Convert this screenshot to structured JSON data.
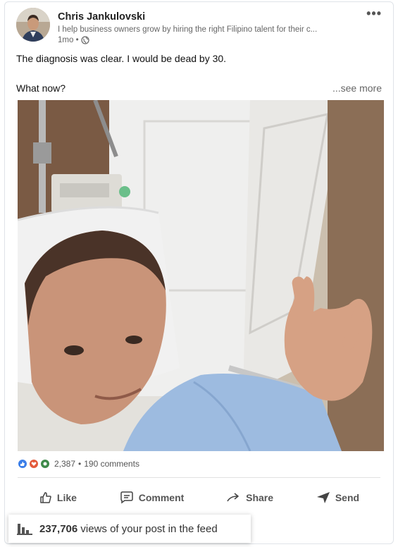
{
  "post": {
    "author": "Chris Jankulovski",
    "headline": "I help business owners grow by hiring the right Filipino talent for their c...",
    "time": "1mo •",
    "body_line1": "The diagnosis was clear. I would be dead by 30.",
    "body_line2": "What now?",
    "see_more": "...see more",
    "menu": "•••"
  },
  "social": {
    "reaction_count": "2,387",
    "separator": "•",
    "comments": "190 comments"
  },
  "actions": {
    "like": "Like",
    "comment": "Comment",
    "share": "Share",
    "send": "Send"
  },
  "views": {
    "count": "237,706",
    "text": "views of your post in the feed"
  },
  "colors": {
    "like_blue": "#3b7ee8",
    "love_red": "#e35a3b",
    "insight_green": "#3f8a4a"
  }
}
